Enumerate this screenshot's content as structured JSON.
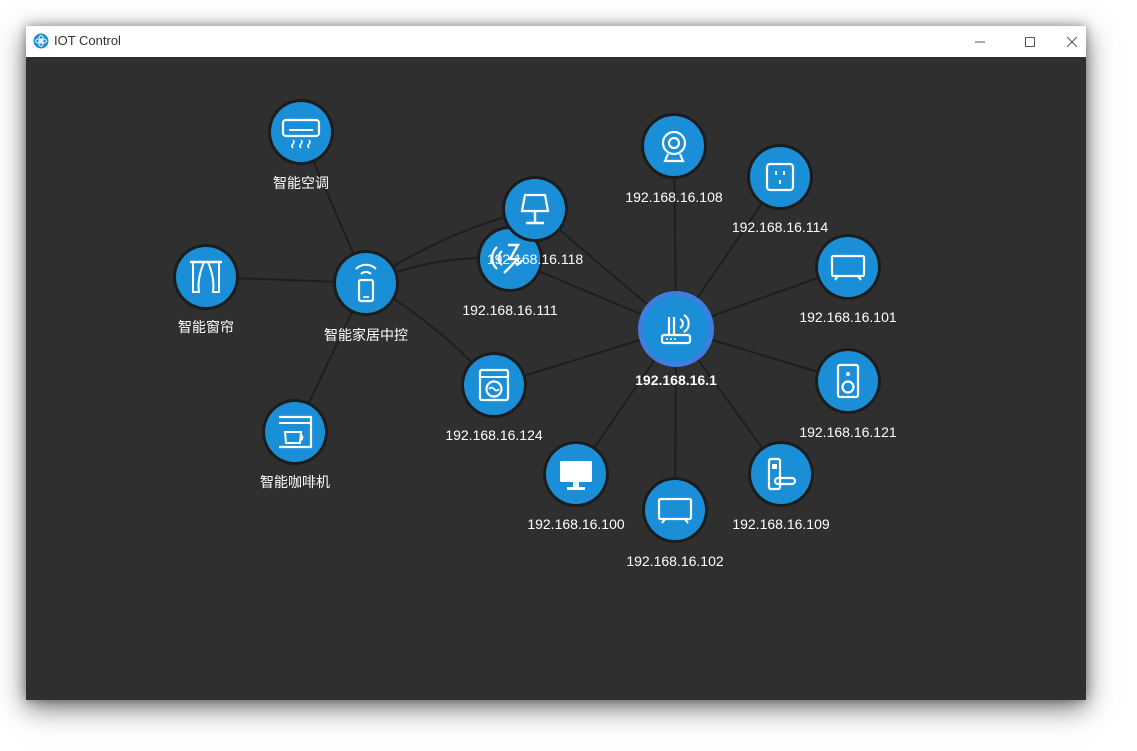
{
  "window": {
    "title": "IOT Control",
    "app_icon": "iot-logo-icon",
    "controls": [
      "minimize-icon",
      "maximize-icon",
      "close-icon"
    ]
  },
  "colors": {
    "canvas_background": "#2f2f2f",
    "node_fill": "#1a8fd8",
    "node_ring": "#1c1c1c",
    "hub_fill": "#1a8fd8",
    "hub_glow": "#3d7ee0",
    "edge": "#1e1e1e",
    "label": "#ffffff"
  },
  "topology": {
    "hub": {
      "id": "router",
      "icon": "wifi-router-icon",
      "label": "192.168.16.1"
    },
    "devices": [
      {
        "id": "camera",
        "icon": "webcam-icon",
        "label": "192.168.16.108",
        "parent": "router"
      },
      {
        "id": "socket",
        "icon": "power-socket-icon",
        "label": "192.168.16.114",
        "parent": "router"
      },
      {
        "id": "tv-101",
        "icon": "tv-icon",
        "label": "192.168.16.101",
        "parent": "router"
      },
      {
        "id": "speaker",
        "icon": "speaker-icon",
        "label": "192.168.16.121",
        "parent": "router"
      },
      {
        "id": "door-lock",
        "icon": "door-lock-icon",
        "label": "192.168.16.109",
        "parent": "router"
      },
      {
        "id": "tv-102",
        "icon": "tv-icon",
        "label": "192.168.16.102",
        "parent": "router"
      },
      {
        "id": "monitor",
        "icon": "monitor-icon",
        "label": "192.168.16.100",
        "parent": "router"
      },
      {
        "id": "washer",
        "icon": "washing-machine-icon",
        "label": "192.168.16.124",
        "parent": "router"
      },
      {
        "id": "sensor",
        "icon": "wireless-sensor-icon",
        "label": "192.168.16.111",
        "parent": "router"
      },
      {
        "id": "lamp",
        "icon": "table-lamp-icon",
        "label": "192.168.16.118",
        "parent": "router"
      },
      {
        "id": "smart-hub",
        "icon": "smart-phone-remote-icon",
        "label": "智能家居中控"
      },
      {
        "id": "ac",
        "icon": "air-conditioner-icon",
        "label": "智能空调",
        "parent": "smart-hub"
      },
      {
        "id": "curtain",
        "icon": "curtain-icon",
        "label": "智能窗帘",
        "parent": "smart-hub"
      },
      {
        "id": "coffee",
        "icon": "coffee-machine-icon",
        "label": "智能咖啡机",
        "parent": "smart-hub"
      }
    ],
    "extra_links": [
      [
        "smart-hub",
        "lamp"
      ],
      [
        "smart-hub",
        "sensor"
      ],
      [
        "smart-hub",
        "washer"
      ]
    ]
  }
}
